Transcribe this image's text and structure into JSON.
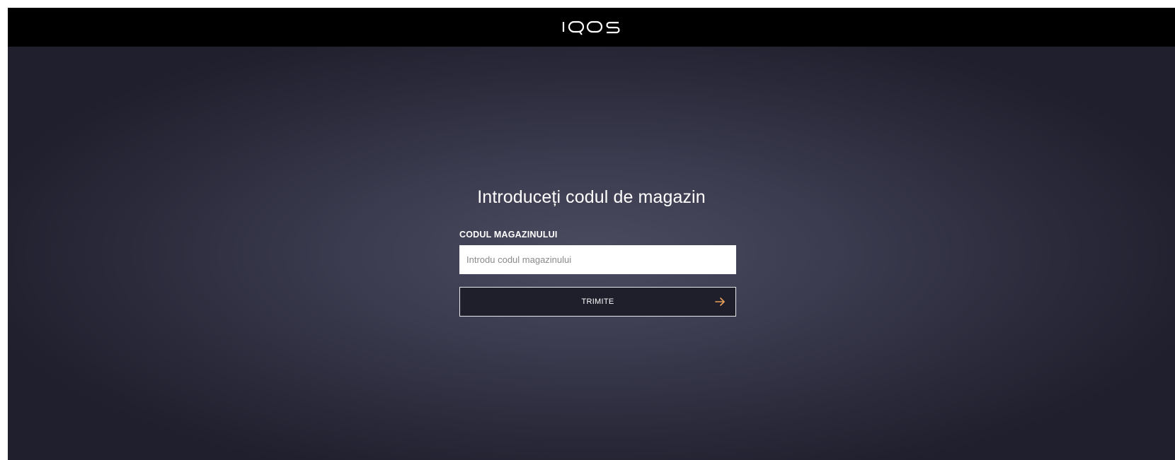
{
  "header": {
    "logo_text": "IQOS",
    "logo_icon": "iqos-wordmark-icon"
  },
  "main": {
    "title": "Introduceți codul de magazin",
    "field": {
      "label": "CODUL MAGAZINULUI",
      "placeholder": "Introdu codul magazinului",
      "value": ""
    },
    "submit": {
      "label": "TRIMITE",
      "icon": "arrow-right-icon"
    }
  },
  "colors": {
    "header_bg": "#000000",
    "background_center": "#4b4b60",
    "background_edge": "#1f1f2d",
    "button_bg": "#1f1f2c",
    "accent": "#e8a05a",
    "text": "#ffffff"
  }
}
